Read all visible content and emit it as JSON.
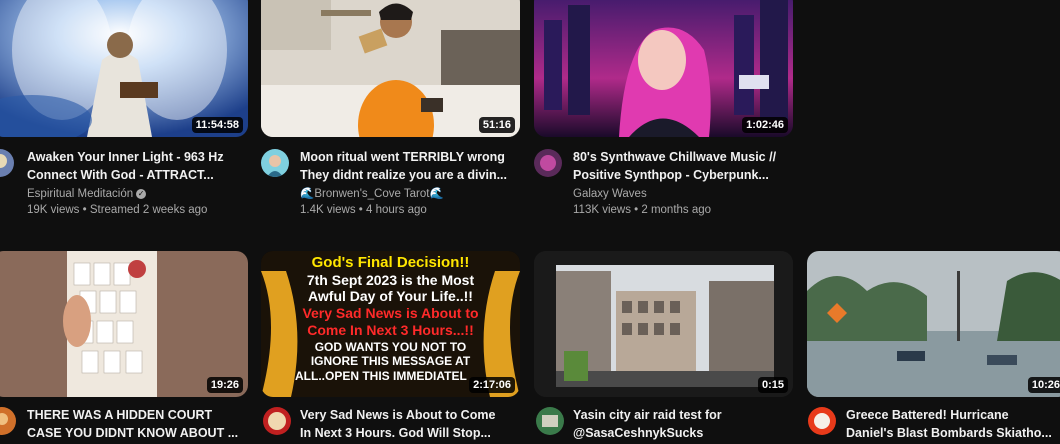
{
  "videos": [
    {
      "title_line1": "Awaken Your Inner Light - 963 Hz",
      "title_line2": "Connect With God - ATTRACT...",
      "channel": "Espiritual Meditación",
      "stats": "19K views • Streamed 2 weeks ago",
      "duration": "11:54:58"
    },
    {
      "title_line1": "Moon ritual went TERRIBLY wrong",
      "title_line2": "They didnt realize you are a divin...",
      "channel": "🌊Bronwen's_Cove Tarot🌊",
      "stats": "1.4K views • 4 hours ago",
      "duration": "51:16"
    },
    {
      "title_line1": "80's Synthwave Chillwave Music //",
      "title_line2": "Positive Synthpop - Cyberpunk...",
      "channel": "Galaxy Waves",
      "stats": "113K views • 2 months ago",
      "duration": "1:02:46"
    },
    {
      "title_line1": "THERE WAS A HIDDEN COURT",
      "title_line2": "CASE YOU DIDNT KNOW ABOUT ...",
      "duration": "19:26"
    },
    {
      "title_line1": "Very Sad News is About to Come",
      "title_line2": "In Next 3 Hours. God Will Stop...",
      "duration": "2:17:06",
      "thumb_text": [
        "God's Final Decision!!",
        "7th Sept 2023 is the Most",
        "Awful Day of Your Life..!!",
        "Very Sad News is About to",
        "Come In Next 3 Hours...!!",
        "GOD WANTS YOU NOT TO",
        "IGNORE THIS MESSAGE AT",
        "ALL..OPEN THIS IMMEDIATEL"
      ]
    },
    {
      "title_line1": "Yasin city air raid test for",
      "title_line2": "@SasaCeshnykSucks",
      "duration": "0:15"
    },
    {
      "title_line1": "Greece Battered! Hurricane",
      "title_line2": "Daniel's Blast Bombards Skiatho...",
      "duration": "10:26"
    }
  ]
}
